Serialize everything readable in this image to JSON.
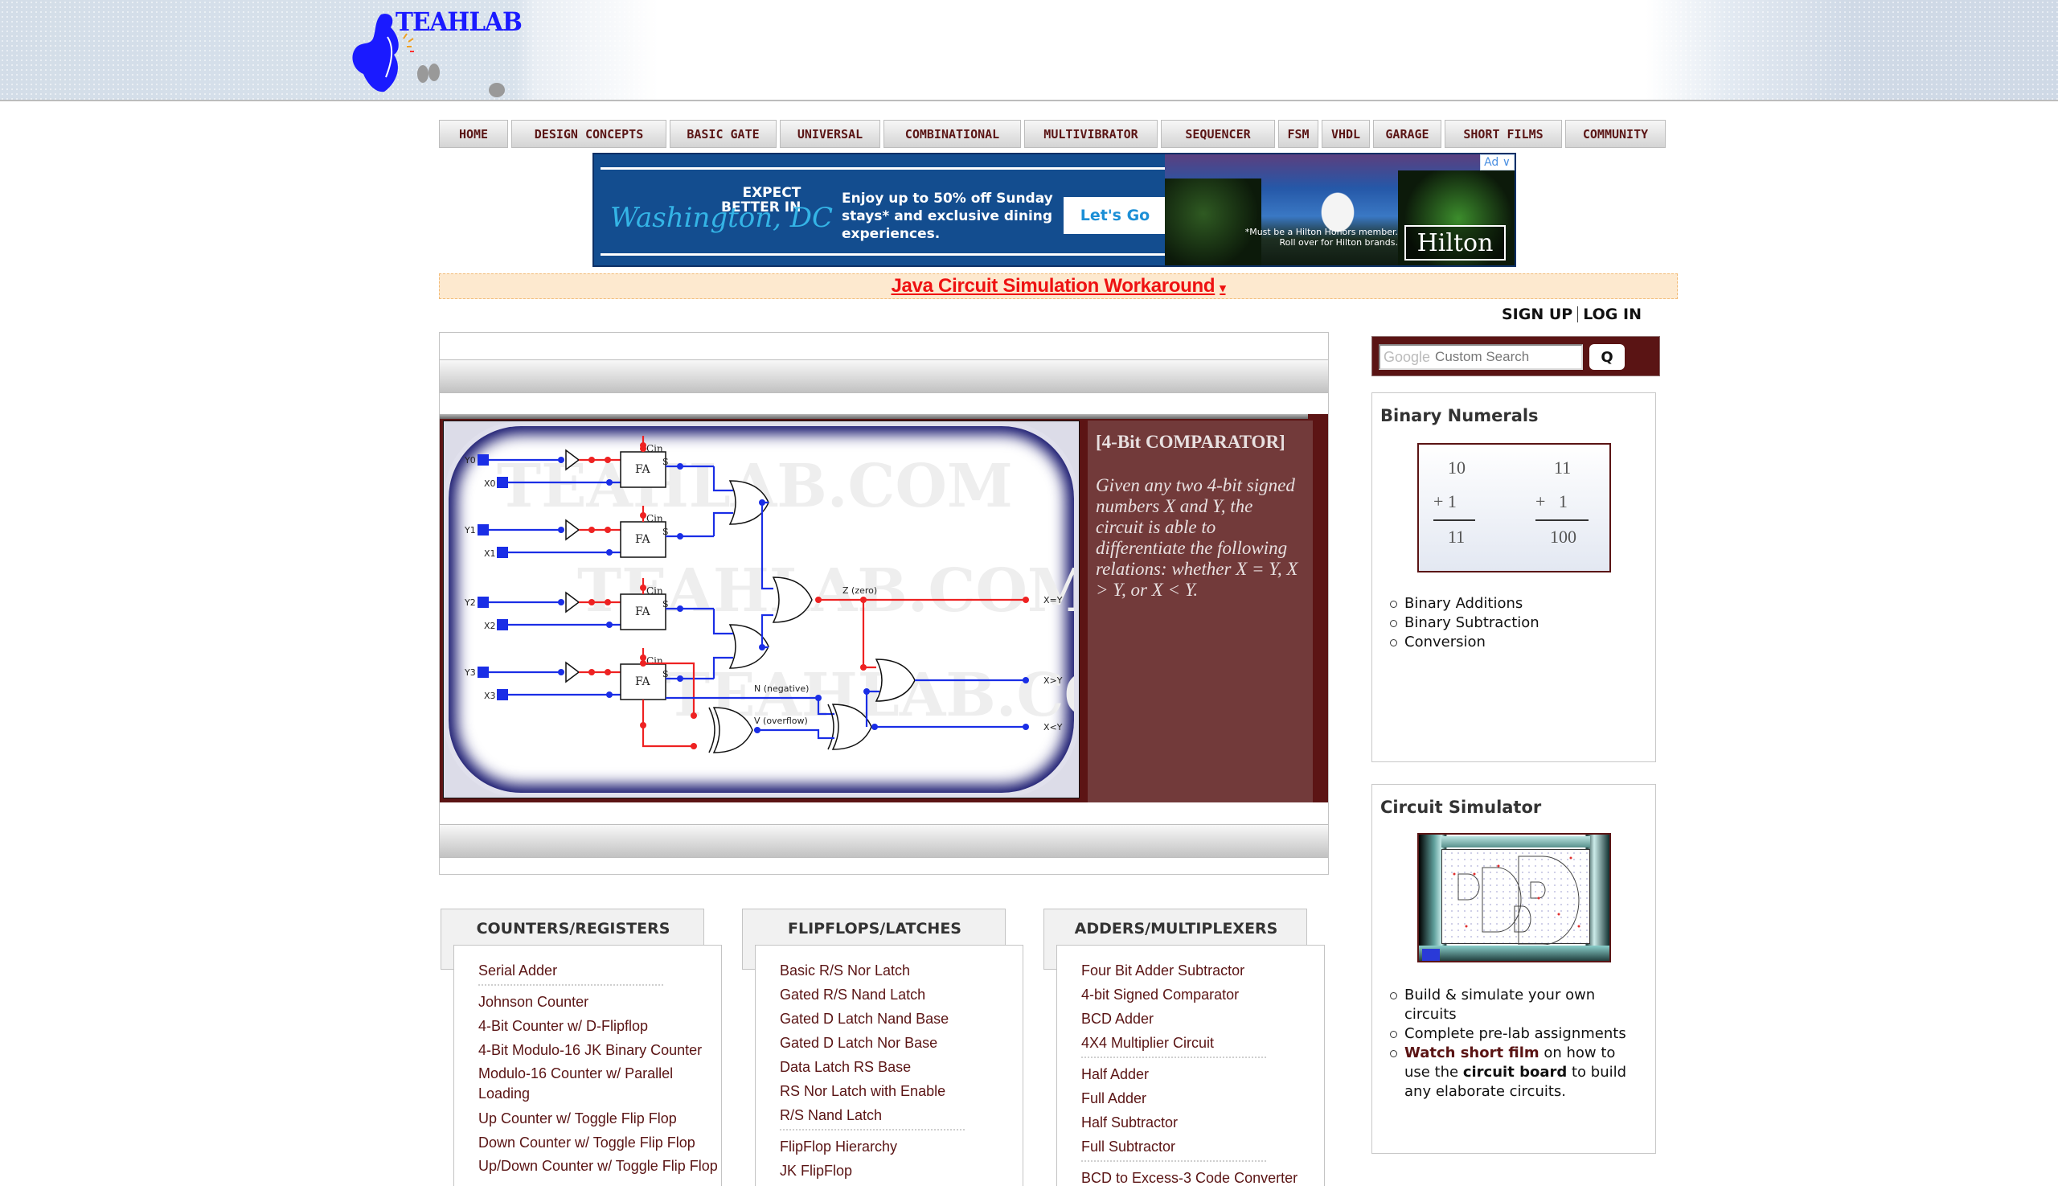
{
  "site": {
    "logo_text": "TEAHLAB"
  },
  "nav": [
    {
      "label": "HOME"
    },
    {
      "label": "DESIGN CONCEPTS"
    },
    {
      "label": "BASIC GATE"
    },
    {
      "label": "UNIVERSAL"
    },
    {
      "label": "COMBINATIONAL"
    },
    {
      "label": "MULTIVIBRATOR"
    },
    {
      "label": "SEQUENCER"
    },
    {
      "label": "FSM"
    },
    {
      "label": "VHDL"
    },
    {
      "label": "GARAGE"
    },
    {
      "label": "SHORT FILMS"
    },
    {
      "label": "COMMUNITY"
    }
  ],
  "ad": {
    "badge": "Ad ∨",
    "expect": "EXPECT",
    "better_in": "BETTER IN",
    "city": "Washington, DC",
    "offer": "Enjoy up to 50% off Sunday stays* and exclusive dining experiences.",
    "cta": "Let's Go",
    "fine_print_1": "*Must be a Hilton Honors member.",
    "fine_print_2": "Roll over for Hilton brands.",
    "brand": "Hilton"
  },
  "notice": {
    "label": "Java Circuit Simulation Workaround",
    "caret": "▾"
  },
  "auth": {
    "sign_up": "SIGN UP",
    "log_in": "LOG IN"
  },
  "search": {
    "google": "Google",
    "placeholder": "Custom Search",
    "button": "Q"
  },
  "slide": {
    "title": "[4-Bit COMPARATOR]",
    "description": "Given any two 4-bit signed numbers X and Y, the circuit is able to differentiate the following relations: whether X = Y, X > Y, or X < Y.",
    "watermark": "TEAHLAB.COM",
    "diagram": {
      "inputs": [
        "Y0",
        "X0",
        "Y1",
        "X1",
        "Y2",
        "X2",
        "Y3",
        "X3"
      ],
      "block_label": "FA",
      "cin_label": "Cin",
      "sum_label": "S",
      "signals": [
        "Z (zero)",
        "N (negative)",
        "V (overflow)"
      ],
      "outputs": [
        "X=Y",
        "X>Y",
        "X<Y"
      ]
    }
  },
  "categories": [
    {
      "title": "COUNTERS/REGISTERS",
      "groups": [
        [
          "Serial Adder"
        ],
        [
          "Johnson Counter",
          "4-Bit Counter w/ D-Flipflop",
          "4-Bit Modulo-16 JK Binary Counter",
          "Modulo-16 Counter w/ Parallel Loading",
          "Up Counter w/ Toggle Flip Flop",
          "Down Counter w/ Toggle Flip Flop",
          "Up/Down Counter w/ Toggle Flip Flop"
        ]
      ]
    },
    {
      "title": "FLIPFLOPS/LATCHES",
      "groups": [
        [
          "Basic R/S Nor Latch",
          "Gated R/S Nand Latch",
          "Gated D Latch Nand Base",
          "Gated D Latch Nor Base",
          "Data Latch RS Base",
          "RS Nor Latch with Enable",
          "R/S Nand Latch"
        ],
        [
          "FlipFlop Hierarchy",
          "JK FlipFlop"
        ]
      ]
    },
    {
      "title": "ADDERS/MULTIPLEXERS",
      "groups": [
        [
          "Four Bit Adder Subtractor",
          "4-bit Signed Comparator",
          "BCD Adder",
          "4X4 Multiplier Circuit"
        ],
        [
          "Half Adder",
          "Full Adder",
          "Half Subtractor",
          "Full Subtractor"
        ],
        [
          "BCD to Excess-3 Code Converter"
        ]
      ]
    }
  ],
  "widgets": {
    "binary": {
      "title": "Binary Numerals",
      "example": {
        "left": {
          "a": "10",
          "b": "+ 1",
          "sum": "11"
        },
        "right": {
          "a": "11",
          "b": "+   1",
          "sum": "100"
        }
      },
      "items": [
        "Binary Additions",
        "Binary Subtraction",
        "Conversion"
      ]
    },
    "simulator": {
      "title": "Circuit Simulator",
      "items": [
        {
          "text": "Build & simulate your own circuits"
        },
        {
          "text": "Complete pre-lab assignments"
        },
        {
          "link": "Watch short film",
          "text1": " on how to use the ",
          "bold": "circuit board",
          "text2": " to build any elaborate circuits."
        }
      ]
    }
  }
}
